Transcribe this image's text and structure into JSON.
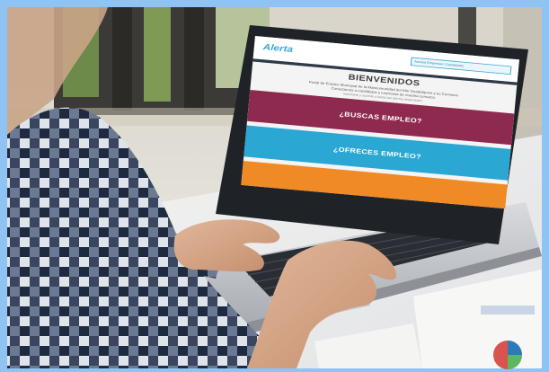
{
  "photo": {
    "description_colors": {
      "sky_frame": "#8fc3f3",
      "laptop_body": "#c9ccd0",
      "screen_bezel": "#1f2328",
      "shirt_dark": "#1e2a40",
      "shirt_light": "#dfe3ea"
    }
  },
  "screen": {
    "logo_text": "Alerta",
    "login_text": "Acceso Empresas / Candidatos",
    "title": "BIENVENIDOS",
    "intro_line_1": "Portal de Empleo Municipal de la Mancomunidad del Alto Guadalquivir y su Comarca",
    "intro_line_2": "Conectamos a candidatos y empresas de nuestra comarca",
    "intro_line_3": "Inscríbete y accede a todas las ofertas disponibles",
    "primary_button": "¿BUSCAS EMPLEO?",
    "secondary_button": "¿OFRECES EMPLEO?",
    "colors": {
      "employ_button": "#8e2a4f",
      "offer_button": "#2aa7d2",
      "third_button": "#f08a24"
    }
  }
}
